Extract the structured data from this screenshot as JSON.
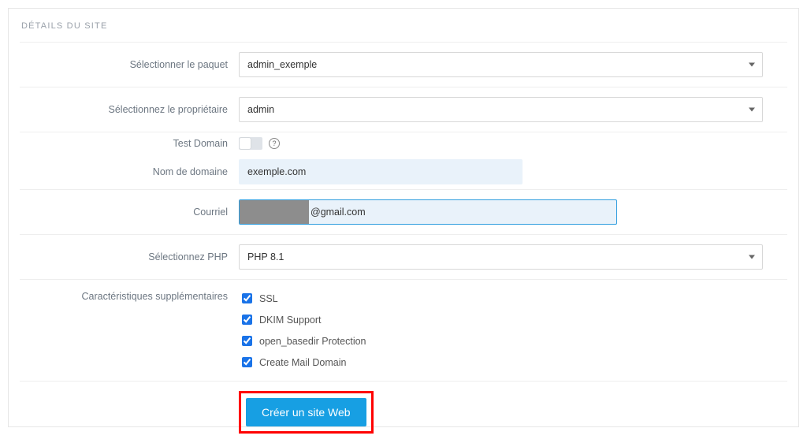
{
  "panel": {
    "title": "DÉTAILS DU SITE"
  },
  "form": {
    "package": {
      "label": "Sélectionner le paquet",
      "value": "admin_exemple"
    },
    "owner": {
      "label": "Sélectionnez le propriétaire",
      "value": "admin"
    },
    "test_domain": {
      "label": "Test Domain",
      "help": "?"
    },
    "domain": {
      "label": "Nom de domaine",
      "value": "exemple.com"
    },
    "email": {
      "label": "Courriel",
      "value_visible": "@gmail.com"
    },
    "php": {
      "label": "Sélectionnez PHP",
      "value": "PHP 8.1"
    },
    "features": {
      "label": "Caractéristiques supplémentaires",
      "items": [
        {
          "label": "SSL",
          "checked": true
        },
        {
          "label": "DKIM Support",
          "checked": true
        },
        {
          "label": "open_basedir Protection",
          "checked": true
        },
        {
          "label": "Create Mail Domain",
          "checked": true
        }
      ]
    },
    "submit": {
      "label": "Créer un site Web"
    }
  }
}
